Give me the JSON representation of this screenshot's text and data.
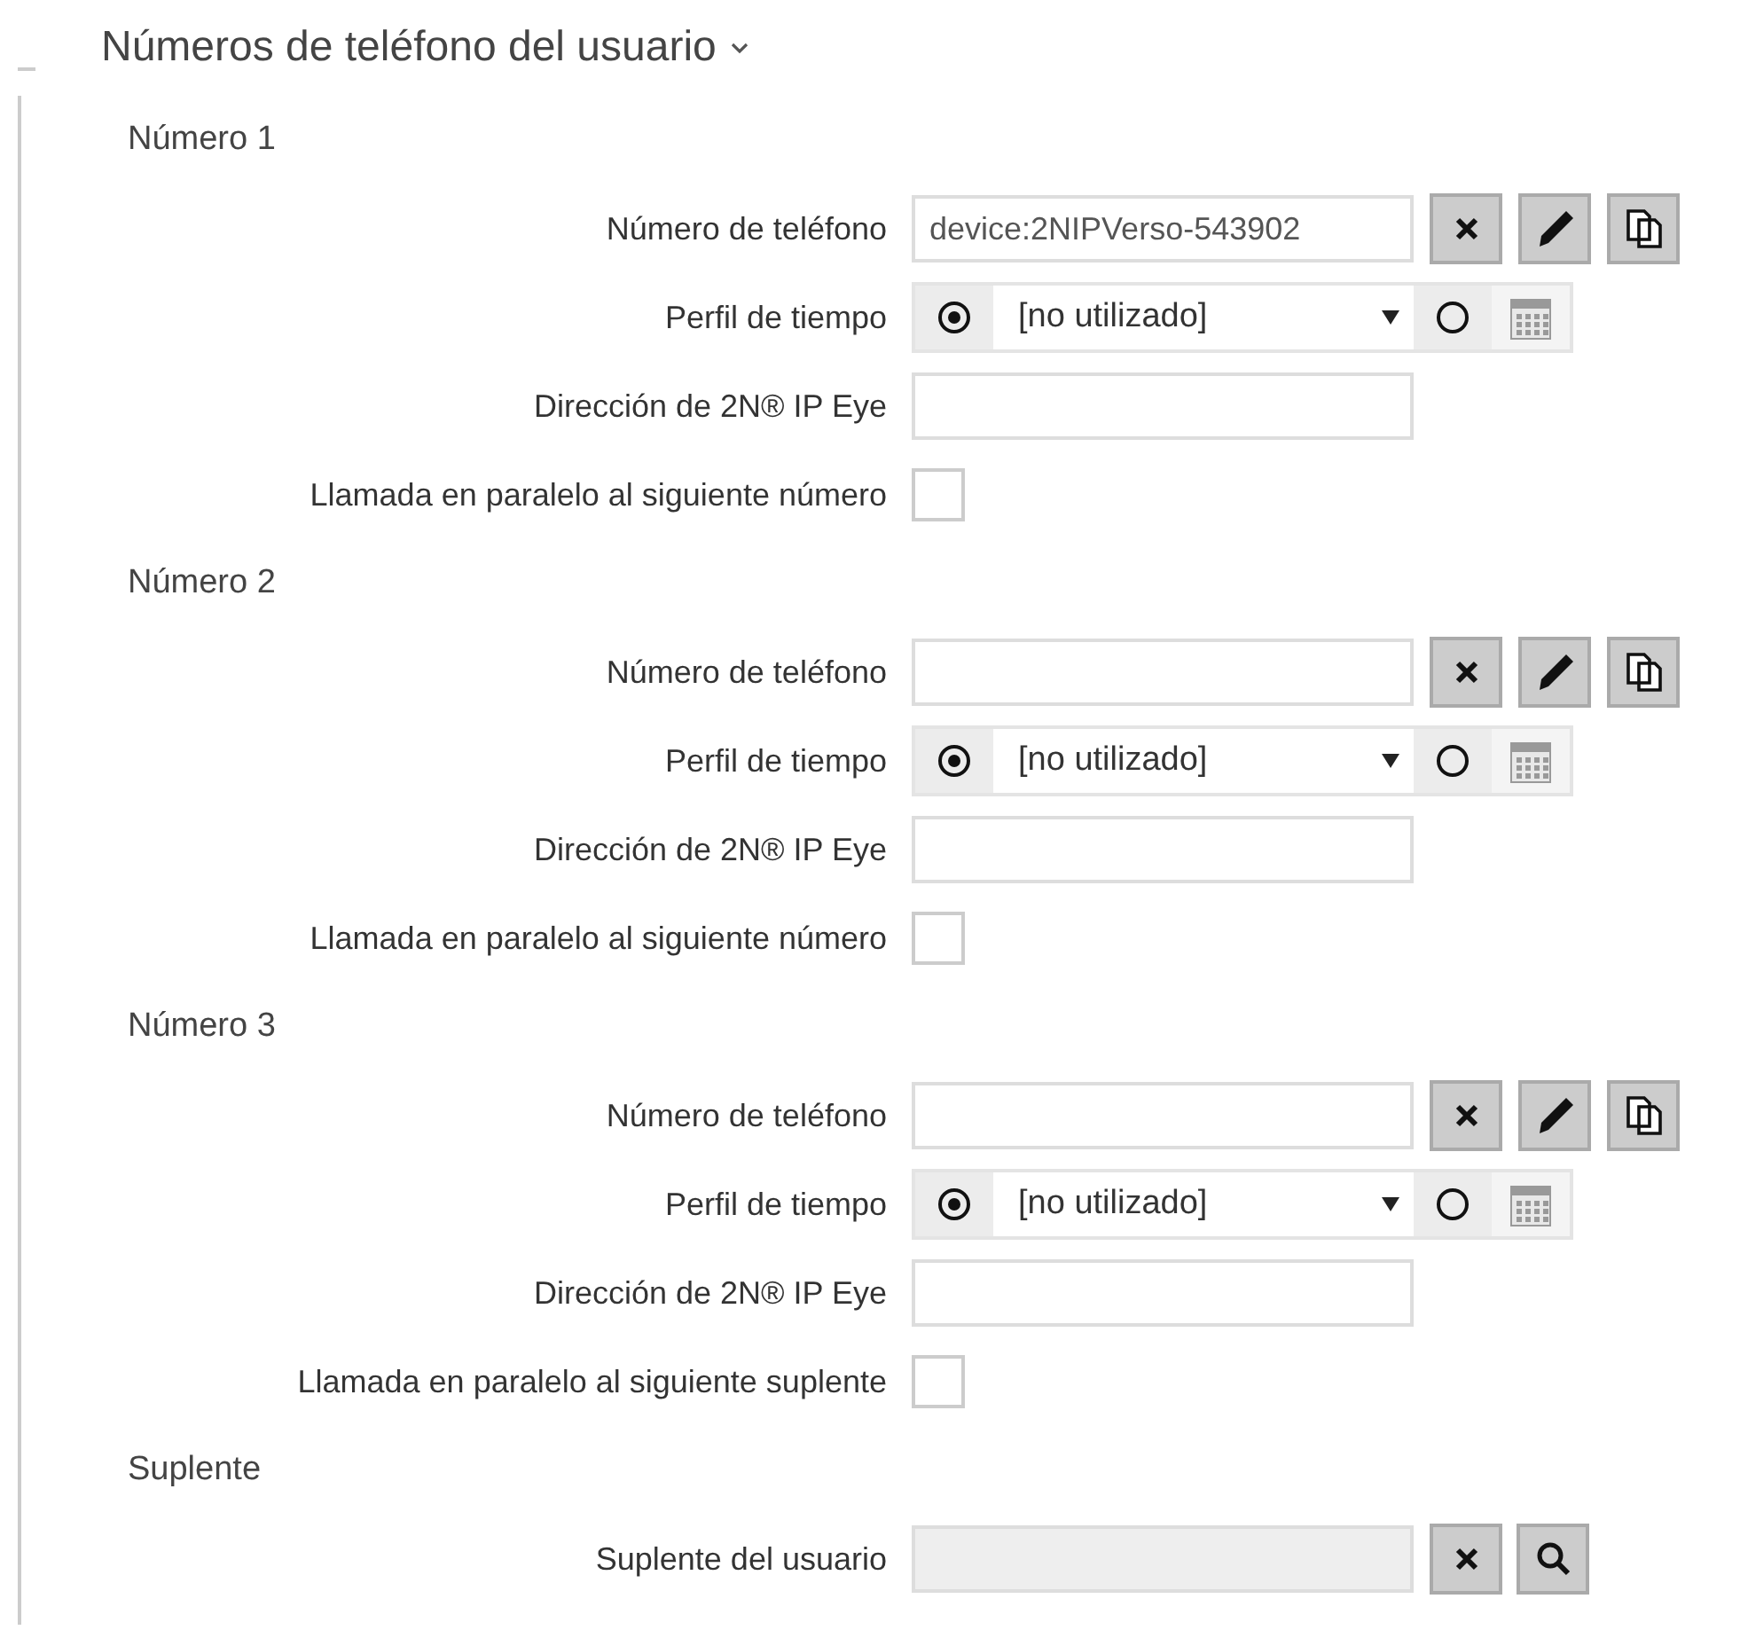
{
  "section": {
    "title": "Números de teléfono del usuario",
    "expanded": true
  },
  "groups": [
    {
      "title": "Número 1",
      "rows": [
        {
          "kind": "phone",
          "label": "Número de teléfono",
          "value": "device:2NIPVerso-543902"
        },
        {
          "kind": "profile",
          "label": "Perfil de tiempo",
          "value": "[no utilizado]",
          "use_profile": true
        },
        {
          "kind": "text",
          "label": "Dirección de 2N® IP Eye"
        },
        {
          "kind": "checkbox",
          "label": "Llamada en paralelo al siguiente número",
          "checked": false
        }
      ]
    },
    {
      "title": "Número 2",
      "rows": [
        {
          "kind": "phone",
          "label": "Número de teléfono"
        },
        {
          "kind": "profile",
          "label": "Perfil de tiempo",
          "value": "[no utilizado]",
          "use_profile": true
        },
        {
          "kind": "text",
          "label": "Dirección de 2N® IP Eye"
        },
        {
          "kind": "checkbox",
          "label": "Llamada en paralelo al siguiente número",
          "checked": false
        }
      ]
    },
    {
      "title": "Número 3",
      "rows": [
        {
          "kind": "phone",
          "label": "Número de teléfono"
        },
        {
          "kind": "profile",
          "label": "Perfil de tiempo",
          "value": "[no utilizado]",
          "use_profile": true
        },
        {
          "kind": "text",
          "label": "Dirección de 2N® IP Eye"
        },
        {
          "kind": "checkbox",
          "label": "Llamada en paralelo al siguiente suplente",
          "checked": false
        }
      ]
    },
    {
      "title": "Suplente",
      "rows": [
        {
          "kind": "lookup",
          "label": "Suplente del usuario",
          "disabled": true
        }
      ]
    }
  ]
}
